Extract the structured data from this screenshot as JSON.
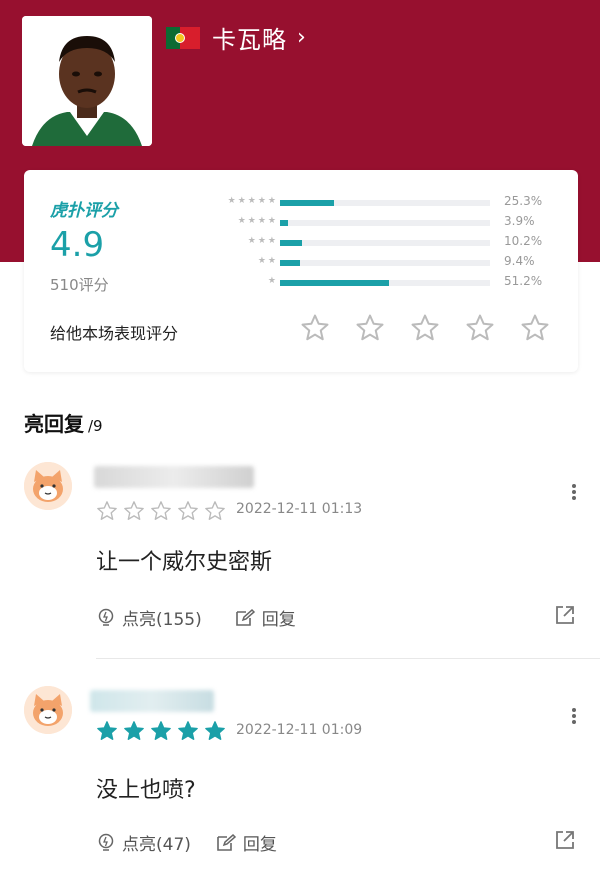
{
  "player": {
    "name": "卡瓦略",
    "chevron": "›",
    "flag_colors": {
      "green": "#0b6b33",
      "red": "#d81e2c"
    }
  },
  "rating": {
    "brand": "虎扑评分",
    "score": "4.9",
    "count": "510评分",
    "distribution": [
      {
        "stars": 5,
        "percent_text": "25.3%",
        "percent": 25.3
      },
      {
        "stars": 4,
        "percent_text": "3.9%",
        "percent": 3.9
      },
      {
        "stars": 3,
        "percent_text": "10.2%",
        "percent": 10.2
      },
      {
        "stars": 2,
        "percent_text": "9.4%",
        "percent": 9.4
      },
      {
        "stars": 1,
        "percent_text": "51.2%",
        "percent": 51.2
      }
    ],
    "prompt": "给他本场表现评分",
    "accent": "#1ba0a8"
  },
  "replies": {
    "title": "亮回复",
    "count": "/9",
    "comments": [
      {
        "stars_filled": 0,
        "date": "2022-12-11 01:13",
        "text": "让一个威尔史密斯",
        "like_label": "点亮(155)",
        "reply_label": "回复"
      },
      {
        "stars_filled": 5,
        "date": "2022-12-11 01:09",
        "text": "没上也喷?",
        "like_label": "点亮(47)",
        "reply_label": "回复"
      }
    ]
  },
  "colors": {
    "header_bg": "#97102f",
    "star_outline": "#bbbbbb",
    "star_filled": "#1ba0a8"
  }
}
